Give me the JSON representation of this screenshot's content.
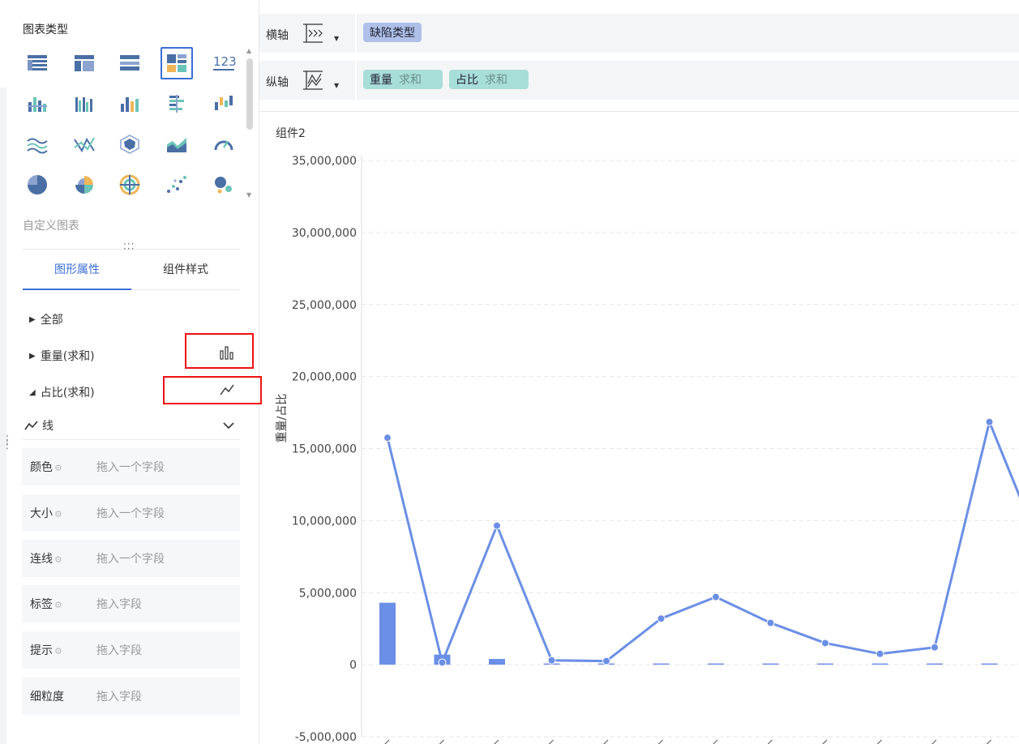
{
  "left": {
    "chart_type_title": "图表类型",
    "custom_chart": "自定义图表",
    "tabs": [
      "图形属性",
      "组件样式"
    ],
    "tree": {
      "all": "全部",
      "weight": "重量(求和)",
      "ratio": "占比(求和)"
    },
    "line_section": "线",
    "fields": [
      {
        "label": "颜色",
        "placeholder": "拖入一个字段",
        "gear": true
      },
      {
        "label": "大小",
        "placeholder": "拖入一个字段",
        "gear": true
      },
      {
        "label": "连线",
        "placeholder": "拖入一个字段",
        "gear": true
      },
      {
        "label": "标签",
        "placeholder": "拖入字段",
        "gear": true
      },
      {
        "label": "提示",
        "placeholder": "拖入字段",
        "gear": true
      },
      {
        "label": "细粒度",
        "placeholder": "拖入字段",
        "gear": false
      }
    ],
    "icon_num_text": "123"
  },
  "axes": {
    "x_label": "横轴",
    "y_label": "纵轴",
    "x_pill": "缺陷类型",
    "y_pills": [
      {
        "field": "重量",
        "agg": "求和"
      },
      {
        "field": "占比",
        "agg": "求和"
      }
    ]
  },
  "colors": {
    "accent": "#3b6fd6",
    "series": "#6b8fe6",
    "pill_x": "#aec0e8",
    "pill_y": "#a8ded8",
    "highlight": "#e11111"
  },
  "chart": {
    "component_title": "组件2",
    "ylabel": "重量/占比"
  },
  "chart_data": {
    "type": "bar",
    "title": "组件2",
    "ylabel": "重量/占比",
    "ylim": [
      -5000000,
      35000000
    ],
    "yticks": [
      -5000000,
      0,
      5000000,
      10000000,
      15000000,
      20000000,
      25000000,
      30000000,
      35000000
    ],
    "ytick_labels": [
      "-5,000,000",
      "0",
      "5,000,000",
      "10,000,000",
      "15,000,000",
      "20,000,000",
      "25,000,000",
      "30,000,000",
      "35,000,000"
    ],
    "grid": true,
    "series": [
      {
        "type": "bar",
        "values": [
          4300000,
          700000,
          400000,
          20000,
          20000,
          20000,
          20000,
          20000,
          20000,
          20000,
          20000,
          20000,
          20000
        ]
      },
      {
        "type": "line",
        "values": [
          15750000,
          150000,
          9650000,
          300000,
          250000,
          3200000,
          4700000,
          2900000,
          1500000,
          750000,
          1200000,
          16850000,
          7500000
        ]
      }
    ]
  }
}
